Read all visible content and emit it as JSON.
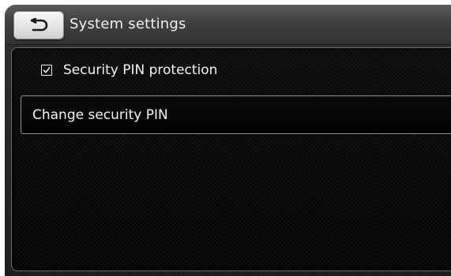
{
  "header": {
    "back_icon": "back-arrow-icon",
    "title": "System settings"
  },
  "menu": {
    "items": [
      {
        "label": "Security PIN protection",
        "type": "checkbox",
        "checked": true,
        "icon": "checkbox-checked-icon"
      },
      {
        "label": "Change security PIN",
        "type": "action",
        "selected": true
      }
    ]
  },
  "colors": {
    "text": "#f4f4f4",
    "header_bg": "#3f3f3f",
    "panel_bg": "#050505",
    "button_bg": "#e4e4e4",
    "focus_border": "#8c8c8c"
  }
}
